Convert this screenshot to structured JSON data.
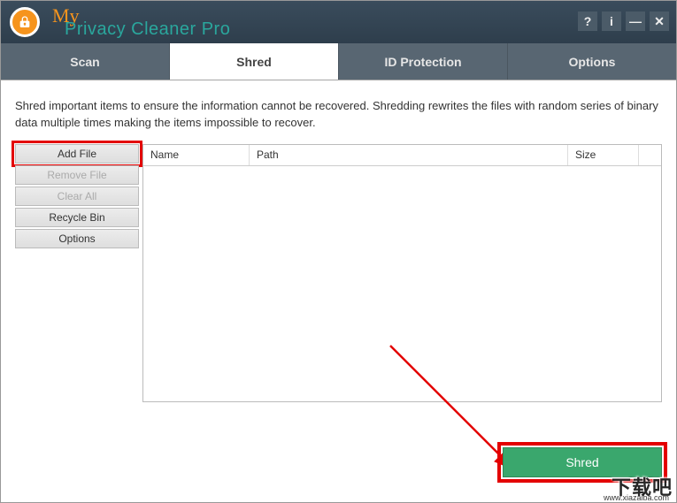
{
  "brand": {
    "my": "My",
    "title": "Privacy Cleaner Pro"
  },
  "titlebar": {
    "help": "?",
    "info": "i",
    "minimize": "—",
    "close": "✕"
  },
  "tabs": {
    "scan": "Scan",
    "shred": "Shred",
    "id_protection": "ID Protection",
    "options": "Options"
  },
  "description": "Shred important items to ensure the information cannot be recovered. Shredding rewrites the files with random series of binary data multiple times making the items impossible to recover.",
  "side": {
    "add_file": "Add File",
    "remove_file": "Remove File",
    "clear_all": "Clear All",
    "recycle_bin": "Recycle Bin",
    "options": "Options"
  },
  "columns": {
    "name": "Name",
    "path": "Path",
    "size": "Size"
  },
  "action": {
    "shred": "Shred"
  },
  "watermark": {
    "main": "下载吧",
    "sub": "www.xiazaiba.com"
  }
}
